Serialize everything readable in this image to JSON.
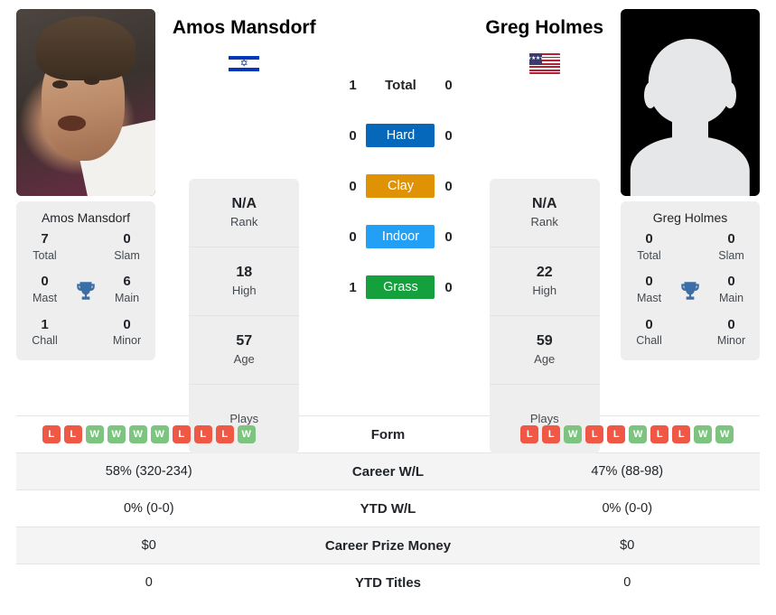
{
  "players": {
    "left": {
      "name": "Amos Mansdorf",
      "photo_caption": "Amos Mansdorf",
      "country_flag": "israel-flag",
      "rank": "N/A",
      "rank_label": "Rank",
      "high": "18",
      "high_label": "High",
      "age": "57",
      "age_label": "Age",
      "plays_label": "Plays",
      "plays_value": "",
      "titles": {
        "total": "7",
        "total_label": "Total",
        "slam": "0",
        "slam_label": "Slam",
        "mast": "0",
        "mast_label": "Mast",
        "main": "6",
        "main_label": "Main",
        "chall": "1",
        "chall_label": "Chall",
        "minor": "0",
        "minor_label": "Minor"
      },
      "form": [
        "L",
        "L",
        "W",
        "W",
        "W",
        "W",
        "L",
        "L",
        "L",
        "W"
      ],
      "career_wl": "58% (320-234)",
      "ytd_wl": "0% (0-0)",
      "career_prize_money": "$0",
      "ytd_titles": "0",
      "surface_wins": {
        "total": "1",
        "hard": "0",
        "clay": "0",
        "indoor": "0",
        "grass": "1"
      }
    },
    "right": {
      "name": "Greg Holmes",
      "photo_caption": "Greg Holmes",
      "country_flag": "usa-flag",
      "rank": "N/A",
      "rank_label": "Rank",
      "high": "22",
      "high_label": "High",
      "age": "59",
      "age_label": "Age",
      "plays_label": "Plays",
      "plays_value": "",
      "titles": {
        "total": "0",
        "total_label": "Total",
        "slam": "0",
        "slam_label": "Slam",
        "mast": "0",
        "mast_label": "Mast",
        "main": "0",
        "main_label": "Main",
        "chall": "0",
        "chall_label": "Chall",
        "minor": "0",
        "minor_label": "Minor"
      },
      "form": [
        "L",
        "L",
        "W",
        "L",
        "L",
        "W",
        "L",
        "L",
        "W",
        "W"
      ],
      "career_wl": "47% (88-98)",
      "ytd_wl": "0% (0-0)",
      "career_prize_money": "$0",
      "ytd_titles": "0",
      "surface_wins": {
        "total": "0",
        "hard": "0",
        "clay": "0",
        "indoor": "0",
        "grass": "0"
      }
    }
  },
  "surfaces": [
    {
      "key": "total",
      "label": "Total",
      "color": "transparent"
    },
    {
      "key": "hard",
      "label": "Hard",
      "color": "#0668bb"
    },
    {
      "key": "clay",
      "label": "Clay",
      "color": "#e09205"
    },
    {
      "key": "indoor",
      "label": "Indoor",
      "color": "#22a0f5"
    },
    {
      "key": "grass",
      "label": "Grass",
      "color": "#14a03c"
    }
  ],
  "comparison_rows": [
    {
      "label": "Form",
      "key": "form"
    },
    {
      "label": "Career W/L",
      "key": "career_wl"
    },
    {
      "label": "YTD W/L",
      "key": "ytd_wl"
    },
    {
      "label": "Career Prize Money",
      "key": "career_prize_money"
    },
    {
      "label": "YTD Titles",
      "key": "ytd_titles"
    }
  ],
  "colors": {
    "win_badge": "#7cc47f",
    "loss_badge": "#ef5844",
    "card_bg": "#eeeeee",
    "row_alt_bg": "#f4f4f4",
    "trophy": "#3a6ea5"
  },
  "flag_labels": {
    "israel": "✡",
    "usa_stars": "★★★★★★"
  }
}
